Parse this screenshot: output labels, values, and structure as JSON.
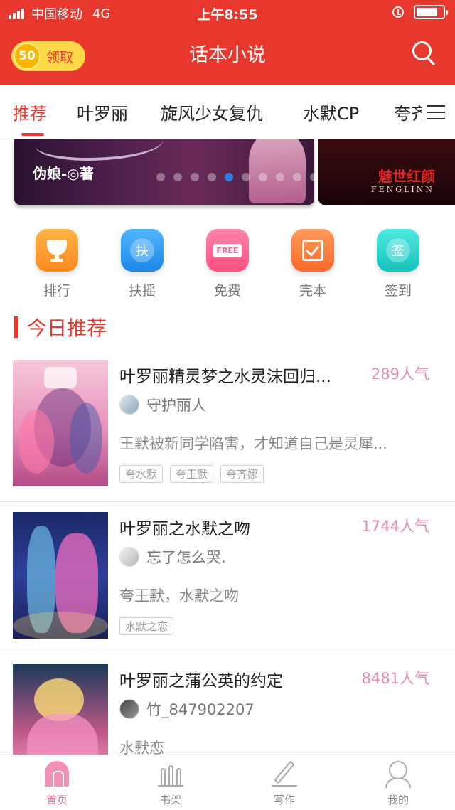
{
  "status_bar": {
    "carrier": "中国移动",
    "network": "4G",
    "time": "上午8:55"
  },
  "header": {
    "coin_count": "50",
    "coin_label": "领取",
    "title": "话本小说",
    "icons": [
      "search-icon"
    ]
  },
  "tabs": [
    {
      "label": "推荐",
      "active": true
    },
    {
      "label": "叶罗丽",
      "active": false
    },
    {
      "label": "旋风少女复仇",
      "active": false
    },
    {
      "label": "水默CP",
      "active": false
    },
    {
      "label": "夸齐",
      "active": false
    }
  ],
  "banner": {
    "main_author": "伪娘-◎著",
    "next_title": "魅世红颜",
    "next_subtitle": "FENGLINN",
    "dots_count": 10,
    "active_dot": 4
  },
  "quick_links": [
    {
      "label": "排行",
      "icon": "trophy-icon",
      "color": "#ff9933"
    },
    {
      "label": "扶摇",
      "icon": "fuyao-icon",
      "glyph": "扶",
      "color": "#2c9cf0"
    },
    {
      "label": "免费",
      "icon": "free-icon",
      "glyph": "FREE",
      "color": "#ff5f8f"
    },
    {
      "label": "完本",
      "icon": "check-icon",
      "color": "#ff7a3d"
    },
    {
      "label": "签到",
      "icon": "signin-icon",
      "glyph": "签",
      "color": "#27d2cc"
    }
  ],
  "section": {
    "title": "今日推荐"
  },
  "books": [
    {
      "title": "叶罗丽精灵梦之水灵沫回归...",
      "popularity": "289人气",
      "author": "守护丽人",
      "description": "王默被新同学陷害，才知道自己是灵犀...",
      "tags": [
        "夸水默",
        "夸王默",
        "夸齐娜"
      ]
    },
    {
      "title": "叶罗丽之水默之吻",
      "popularity": "1744人气",
      "author": "忘了怎么哭.",
      "description": "夸王默，水默之吻",
      "tags": [
        "水默之恋"
      ]
    },
    {
      "title": "叶罗丽之蒲公英的约定",
      "popularity": "8481人气",
      "author": "竹_847902207",
      "description": "水默恋",
      "tags": []
    }
  ],
  "bottom_nav": [
    {
      "label": "首页",
      "icon": "home-icon",
      "active": true
    },
    {
      "label": "书架",
      "icon": "bookshelf-icon",
      "active": false
    },
    {
      "label": "写作",
      "icon": "pen-icon",
      "active": false
    },
    {
      "label": "我的",
      "icon": "profile-icon",
      "active": false
    }
  ],
  "colors": {
    "brand_red": "#e8372c",
    "popularity_pink": "#e88ab0",
    "coin_yellow": "#ffd84a"
  }
}
